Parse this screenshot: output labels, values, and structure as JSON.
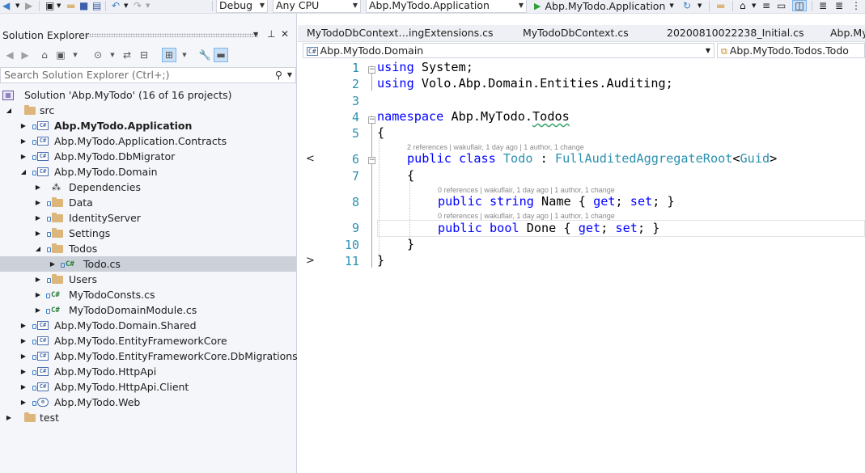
{
  "toolbar": {
    "config": "Debug",
    "platform": "Any CPU",
    "startup_project": "Abp.MyTodo.Application",
    "run_target": "Abp.MyTodo.Application"
  },
  "solution_explorer": {
    "title": "Solution Explorer",
    "search_placeholder": "Search Solution Explorer (Ctrl+;)",
    "tree": [
      {
        "label": "Solution 'Abp.MyTodo' (16 of 16 projects)",
        "icon": "solution-icon",
        "bold": false
      },
      {
        "label": "src",
        "icon": "folder-icon",
        "bold": false
      },
      {
        "label": "Abp.MyTodo.Application",
        "icon": "csharp-project-icon",
        "bold": true
      },
      {
        "label": "Abp.MyTodo.Application.Contracts",
        "icon": "csharp-project-icon",
        "bold": false
      },
      {
        "label": "Abp.MyTodo.DbMigrator",
        "icon": "csharp-project-icon",
        "bold": false
      },
      {
        "label": "Abp.MyTodo.Domain",
        "icon": "csharp-project-icon",
        "bold": false
      },
      {
        "label": "Dependencies",
        "icon": "dependencies-icon",
        "bold": false
      },
      {
        "label": "Data",
        "icon": "folder-icon",
        "bold": false
      },
      {
        "label": "IdentityServer",
        "icon": "folder-icon",
        "bold": false
      },
      {
        "label": "Settings",
        "icon": "folder-icon",
        "bold": false
      },
      {
        "label": "Todos",
        "icon": "folder-icon",
        "bold": false
      },
      {
        "label": "Todo.cs",
        "icon": "csharp-file-icon",
        "bold": false
      },
      {
        "label": "Users",
        "icon": "folder-icon",
        "bold": false
      },
      {
        "label": "MyTodoConsts.cs",
        "icon": "csharp-file-icon",
        "bold": false
      },
      {
        "label": "MyTodoDomainModule.cs",
        "icon": "csharp-file-icon",
        "bold": false
      },
      {
        "label": "Abp.MyTodo.Domain.Shared",
        "icon": "csharp-project-icon",
        "bold": false
      },
      {
        "label": "Abp.MyTodo.EntityFrameworkCore",
        "icon": "csharp-project-icon",
        "bold": false
      },
      {
        "label": "Abp.MyTodo.EntityFrameworkCore.DbMigrations",
        "icon": "csharp-project-icon",
        "bold": false
      },
      {
        "label": "Abp.MyTodo.HttpApi",
        "icon": "csharp-project-icon",
        "bold": false
      },
      {
        "label": "Abp.MyTodo.HttpApi.Client",
        "icon": "csharp-project-icon",
        "bold": false
      },
      {
        "label": "Abp.MyTodo.Web",
        "icon": "web-project-icon",
        "bold": false
      },
      {
        "label": "test",
        "icon": "folder-icon",
        "bold": false
      }
    ]
  },
  "editor": {
    "tabs": [
      "MyTodoDbContext…ingExtensions.cs",
      "MyTodoDbContext.cs",
      "20200810022238_Initial.cs",
      "Abp.My"
    ],
    "nav_project": "Abp.MyTodo.Domain",
    "nav_type": "Abp.MyTodo.Todos.Todo",
    "line_numbers": [
      "1",
      "2",
      "3",
      "4",
      "5",
      "6",
      "7",
      "8",
      "9",
      "10",
      "11"
    ],
    "codelens": {
      "class": "2 references | wakuflair, 1 day ago | 1 author, 1 change",
      "name_prop": "0 references | wakuflair, 1 day ago | 1 author, 1 change",
      "done_prop": "0 references | wakuflair, 1 day ago | 1 author, 1 change"
    },
    "code": {
      "l1": {
        "kw": "using",
        "rest": " System;"
      },
      "l2": {
        "kw": "using",
        "rest": " Volo.Abp.Domain.Entities.Auditing;"
      },
      "l4": {
        "kw": "namespace",
        "ns": " Abp.MyTodo.",
        "squiggle": "Todos"
      },
      "l5": "{",
      "l6": {
        "kw1": "public",
        "kw2": "class",
        "name": "Todo",
        "colon": " : ",
        "base": "FullAuditedAggregateRoot",
        "lt": "<",
        "arg": "Guid",
        "gt": ">"
      },
      "l7": "{",
      "l8": {
        "kw1": "public",
        "kw2": "string",
        "rest1": " Name { ",
        "get": "get",
        "semi1": "; ",
        "set": "set",
        "rest2": "; }"
      },
      "l9": {
        "kw1": "public",
        "kw2": "bool",
        "rest1": " Done { ",
        "get": "get",
        "semi1": "; ",
        "set": "set",
        "rest2": "; }"
      },
      "l10": "}",
      "l11": "}"
    },
    "margin_markers": [
      "<",
      ">"
    ]
  }
}
